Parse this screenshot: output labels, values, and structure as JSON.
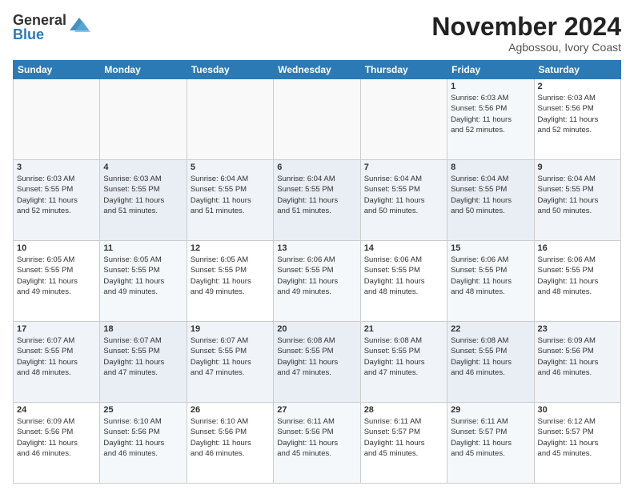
{
  "header": {
    "logo_general": "General",
    "logo_blue": "Blue",
    "title": "November 2024",
    "location": "Agbossou, Ivory Coast"
  },
  "weekdays": [
    "Sunday",
    "Monday",
    "Tuesday",
    "Wednesday",
    "Thursday",
    "Friday",
    "Saturday"
  ],
  "weeks": [
    [
      {
        "day": "",
        "info": ""
      },
      {
        "day": "",
        "info": ""
      },
      {
        "day": "",
        "info": ""
      },
      {
        "day": "",
        "info": ""
      },
      {
        "day": "",
        "info": ""
      },
      {
        "day": "1",
        "info": "Sunrise: 6:03 AM\nSunset: 5:56 PM\nDaylight: 11 hours\nand 52 minutes."
      },
      {
        "day": "2",
        "info": "Sunrise: 6:03 AM\nSunset: 5:56 PM\nDaylight: 11 hours\nand 52 minutes."
      }
    ],
    [
      {
        "day": "3",
        "info": "Sunrise: 6:03 AM\nSunset: 5:55 PM\nDaylight: 11 hours\nand 52 minutes."
      },
      {
        "day": "4",
        "info": "Sunrise: 6:03 AM\nSunset: 5:55 PM\nDaylight: 11 hours\nand 51 minutes."
      },
      {
        "day": "5",
        "info": "Sunrise: 6:04 AM\nSunset: 5:55 PM\nDaylight: 11 hours\nand 51 minutes."
      },
      {
        "day": "6",
        "info": "Sunrise: 6:04 AM\nSunset: 5:55 PM\nDaylight: 11 hours\nand 51 minutes."
      },
      {
        "day": "7",
        "info": "Sunrise: 6:04 AM\nSunset: 5:55 PM\nDaylight: 11 hours\nand 50 minutes."
      },
      {
        "day": "8",
        "info": "Sunrise: 6:04 AM\nSunset: 5:55 PM\nDaylight: 11 hours\nand 50 minutes."
      },
      {
        "day": "9",
        "info": "Sunrise: 6:04 AM\nSunset: 5:55 PM\nDaylight: 11 hours\nand 50 minutes."
      }
    ],
    [
      {
        "day": "10",
        "info": "Sunrise: 6:05 AM\nSunset: 5:55 PM\nDaylight: 11 hours\nand 49 minutes."
      },
      {
        "day": "11",
        "info": "Sunrise: 6:05 AM\nSunset: 5:55 PM\nDaylight: 11 hours\nand 49 minutes."
      },
      {
        "day": "12",
        "info": "Sunrise: 6:05 AM\nSunset: 5:55 PM\nDaylight: 11 hours\nand 49 minutes."
      },
      {
        "day": "13",
        "info": "Sunrise: 6:06 AM\nSunset: 5:55 PM\nDaylight: 11 hours\nand 49 minutes."
      },
      {
        "day": "14",
        "info": "Sunrise: 6:06 AM\nSunset: 5:55 PM\nDaylight: 11 hours\nand 48 minutes."
      },
      {
        "day": "15",
        "info": "Sunrise: 6:06 AM\nSunset: 5:55 PM\nDaylight: 11 hours\nand 48 minutes."
      },
      {
        "day": "16",
        "info": "Sunrise: 6:06 AM\nSunset: 5:55 PM\nDaylight: 11 hours\nand 48 minutes."
      }
    ],
    [
      {
        "day": "17",
        "info": "Sunrise: 6:07 AM\nSunset: 5:55 PM\nDaylight: 11 hours\nand 48 minutes."
      },
      {
        "day": "18",
        "info": "Sunrise: 6:07 AM\nSunset: 5:55 PM\nDaylight: 11 hours\nand 47 minutes."
      },
      {
        "day": "19",
        "info": "Sunrise: 6:07 AM\nSunset: 5:55 PM\nDaylight: 11 hours\nand 47 minutes."
      },
      {
        "day": "20",
        "info": "Sunrise: 6:08 AM\nSunset: 5:55 PM\nDaylight: 11 hours\nand 47 minutes."
      },
      {
        "day": "21",
        "info": "Sunrise: 6:08 AM\nSunset: 5:55 PM\nDaylight: 11 hours\nand 47 minutes."
      },
      {
        "day": "22",
        "info": "Sunrise: 6:08 AM\nSunset: 5:55 PM\nDaylight: 11 hours\nand 46 minutes."
      },
      {
        "day": "23",
        "info": "Sunrise: 6:09 AM\nSunset: 5:56 PM\nDaylight: 11 hours\nand 46 minutes."
      }
    ],
    [
      {
        "day": "24",
        "info": "Sunrise: 6:09 AM\nSunset: 5:56 PM\nDaylight: 11 hours\nand 46 minutes."
      },
      {
        "day": "25",
        "info": "Sunrise: 6:10 AM\nSunset: 5:56 PM\nDaylight: 11 hours\nand 46 minutes."
      },
      {
        "day": "26",
        "info": "Sunrise: 6:10 AM\nSunset: 5:56 PM\nDaylight: 11 hours\nand 46 minutes."
      },
      {
        "day": "27",
        "info": "Sunrise: 6:11 AM\nSunset: 5:56 PM\nDaylight: 11 hours\nand 45 minutes."
      },
      {
        "day": "28",
        "info": "Sunrise: 6:11 AM\nSunset: 5:57 PM\nDaylight: 11 hours\nand 45 minutes."
      },
      {
        "day": "29",
        "info": "Sunrise: 6:11 AM\nSunset: 5:57 PM\nDaylight: 11 hours\nand 45 minutes."
      },
      {
        "day": "30",
        "info": "Sunrise: 6:12 AM\nSunset: 5:57 PM\nDaylight: 11 hours\nand 45 minutes."
      }
    ]
  ]
}
